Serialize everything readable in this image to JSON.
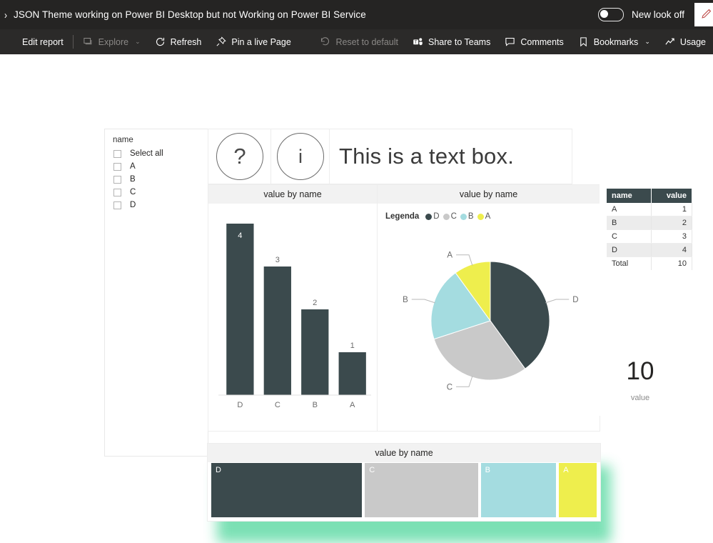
{
  "topbar": {
    "chevron_icon": "chevron-right-icon",
    "title": "JSON Theme working on Power BI Desktop but not Working on Power BI Service",
    "new_look_label": "New look off",
    "edge_button_icon": "pen-icon"
  },
  "toolbar": {
    "items": [
      {
        "label": "Edit report",
        "icon": "edit-report-icon",
        "dim": false
      },
      {
        "label": "Explore",
        "icon": "explore-icon",
        "dim": true,
        "caret": "⌄"
      },
      {
        "label": "Refresh",
        "icon": "refresh-icon",
        "dim": false
      },
      {
        "label": "Pin a live Page",
        "icon": "pin-icon",
        "dim": false
      }
    ],
    "right_items": [
      {
        "label": "Reset to default",
        "icon": "undo-icon",
        "dim": true
      },
      {
        "label": "Share to Teams",
        "icon": "teams-icon",
        "dim": false
      },
      {
        "label": "Comments",
        "icon": "comment-icon",
        "dim": false
      },
      {
        "label": "Bookmarks",
        "icon": "bookmark-icon",
        "dim": false,
        "caret": "⌄"
      },
      {
        "label": "Usage",
        "icon": "usage-metrics-icon",
        "dim": false
      }
    ]
  },
  "slicer": {
    "header": "name",
    "options": [
      "Select all",
      "A",
      "B",
      "C",
      "D"
    ]
  },
  "shapes": {
    "question_glyph": "?",
    "info_glyph": "i",
    "question_icon": "question-circle-icon",
    "info_icon": "info-circle-icon"
  },
  "textbox": {
    "text": "This is a text box."
  },
  "table": {
    "columns": [
      "name",
      "value"
    ],
    "rows": [
      [
        "A",
        "1"
      ],
      [
        "B",
        "2"
      ],
      [
        "C",
        "3"
      ],
      [
        "D",
        "4"
      ]
    ],
    "total_row": [
      "Total",
      "10"
    ]
  },
  "card": {
    "value": "10",
    "label": "value"
  },
  "colors": {
    "D": "#3b4a4d",
    "C": "#c9c9c9",
    "B": "#a4dce0",
    "A": "#eeee4d",
    "glow": "#74dfb1",
    "title_bar": "#f2f2f2",
    "topbar": "#252423"
  },
  "chart_data": [
    {
      "type": "bar",
      "title": "value by name",
      "categories": [
        "D",
        "C",
        "B",
        "A"
      ],
      "values": [
        4,
        3,
        2,
        1
      ],
      "data_labels": [
        "4",
        "3",
        "2",
        "1"
      ],
      "xlabel": "",
      "ylabel": "",
      "ylim": [
        0,
        4
      ],
      "grid": false,
      "series_color": "#3b4a4d"
    },
    {
      "type": "pie",
      "title": "value by name",
      "legend_title": "Legenda",
      "legend_position": "top",
      "categories": [
        "D",
        "C",
        "B",
        "A"
      ],
      "values": [
        4,
        3,
        2,
        1
      ],
      "percentages": [
        40,
        30,
        20,
        10
      ],
      "slice_colors": [
        "#3b4a4d",
        "#c9c9c9",
        "#a4dce0",
        "#eeee4d"
      ],
      "labels": [
        "D",
        "C",
        "B",
        "A"
      ]
    },
    {
      "type": "bar",
      "subtype": "treemap",
      "title": "value by name",
      "categories": [
        "D",
        "C",
        "B",
        "A"
      ],
      "values": [
        4,
        3,
        2,
        1
      ],
      "slice_colors": [
        "#3b4a4d",
        "#c9c9c9",
        "#a4dce0",
        "#eeee4d"
      ]
    }
  ]
}
